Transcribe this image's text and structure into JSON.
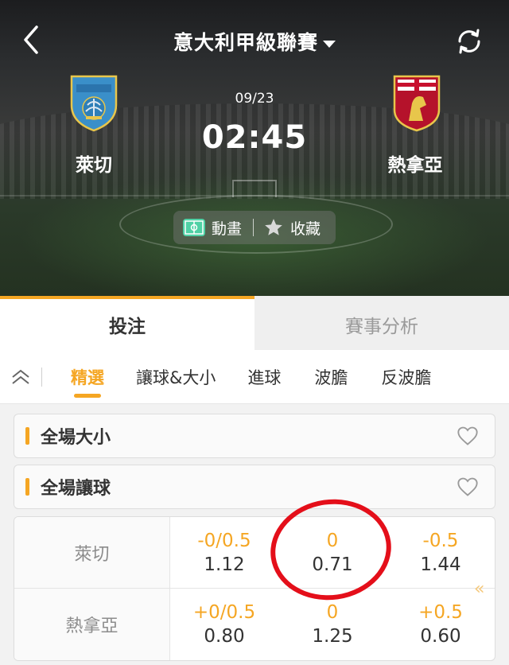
{
  "header": {
    "league": "意大利甲級聯賽",
    "date": "09/23",
    "time": "02:45",
    "home_team": "萊切",
    "away_team": "熱拿亞",
    "animation_label": "動畫",
    "favorite_label": "收藏"
  },
  "main_tabs": [
    {
      "label": "投注",
      "active": true
    },
    {
      "label": "賽事分析",
      "active": false
    }
  ],
  "sub_tabs": [
    {
      "label": "精選",
      "active": true
    },
    {
      "label": "讓球&大小",
      "active": false
    },
    {
      "label": "進球",
      "active": false
    },
    {
      "label": "波膽",
      "active": false
    },
    {
      "label": "反波膽",
      "active": false
    }
  ],
  "markets": [
    {
      "title": "全場大小"
    },
    {
      "title": "全場讓球"
    }
  ],
  "odds": {
    "rows": [
      {
        "team": "萊切",
        "cells": [
          {
            "line": "-0/0.5",
            "price": "1.12"
          },
          {
            "line": "0",
            "price": "0.71"
          },
          {
            "line": "-0.5",
            "price": "1.44"
          }
        ]
      },
      {
        "team": "熱拿亞",
        "cells": [
          {
            "line": "+0/0.5",
            "price": "0.80"
          },
          {
            "line": "0",
            "price": "1.25"
          },
          {
            "line": "+0.5",
            "price": "0.60"
          }
        ]
      }
    ],
    "more_glyph": "«"
  },
  "colors": {
    "accent": "#f5a623",
    "annotation": "#e40f1a",
    "home_badge": "#3a8fc9",
    "away_badge": "#b5122b"
  },
  "icons": [
    "back-arrow-icon",
    "refresh-icon",
    "caret-down-icon",
    "pitch-icon",
    "star-icon",
    "collapse-up-icon",
    "heart-icon"
  ]
}
